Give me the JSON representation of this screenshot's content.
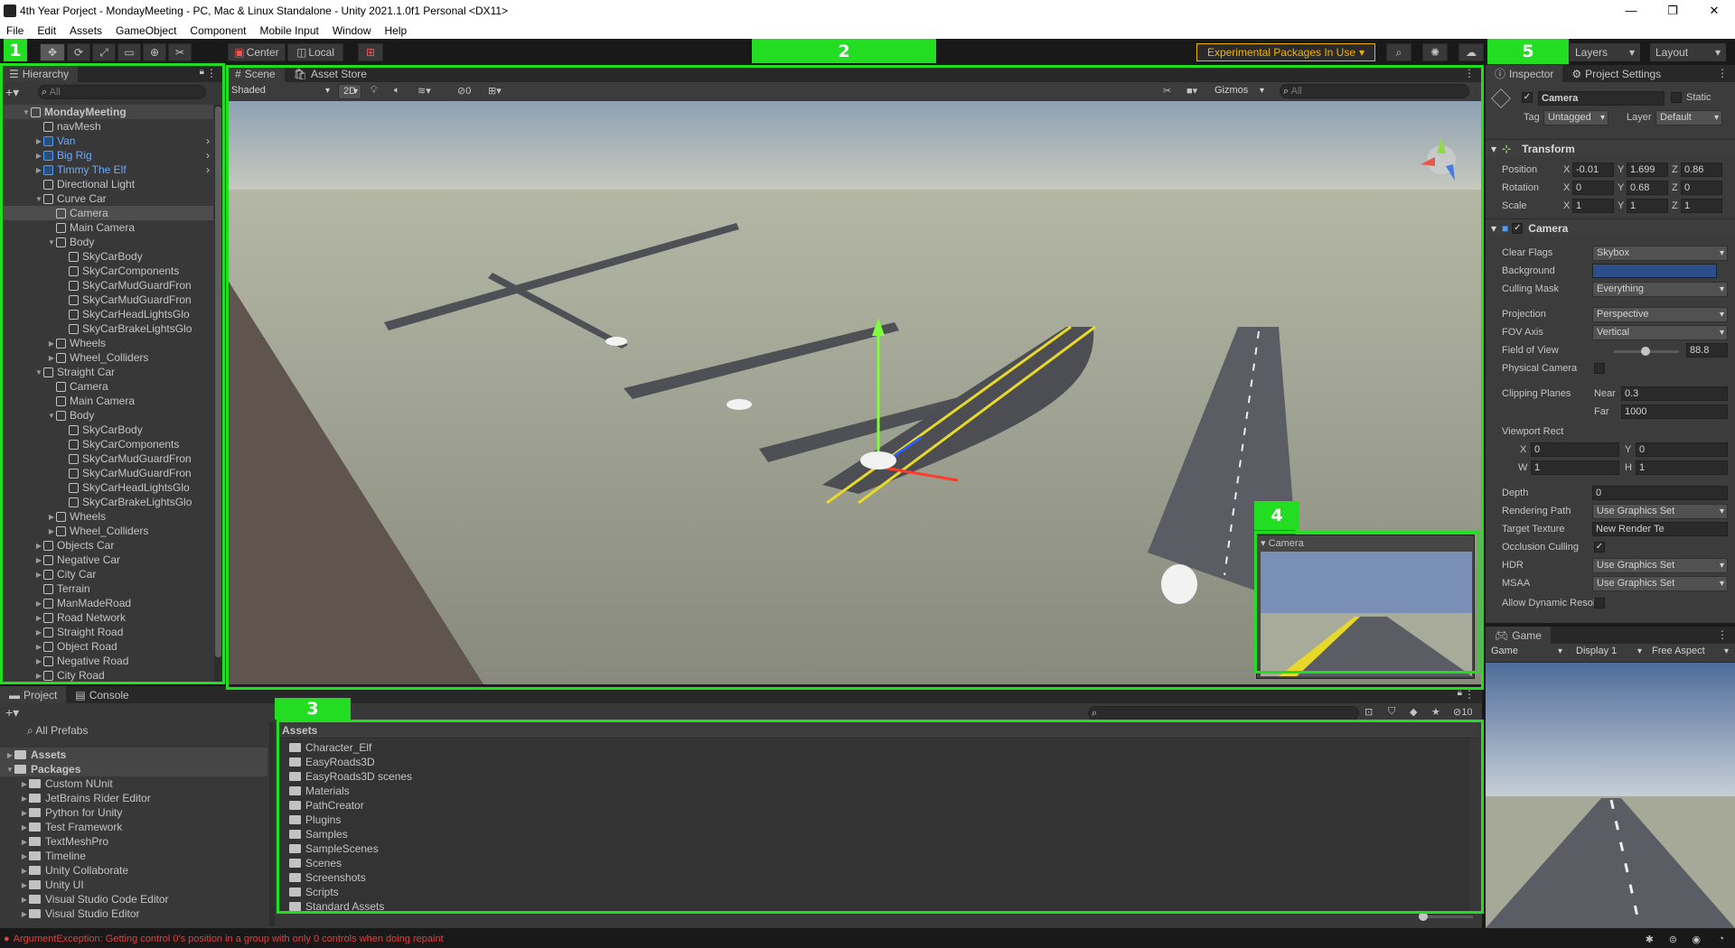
{
  "window": {
    "title": "4th Year Porject - MondayMeeting - PC, Mac & Linux Standalone - Unity 2021.1.0f1 Personal <DX11>",
    "controls": [
      "—",
      "❐",
      "✕"
    ]
  },
  "menu": [
    "File",
    "Edit",
    "Assets",
    "GameObject",
    "Component",
    "Mobile Input",
    "Window",
    "Help"
  ],
  "toolbar": {
    "pivot": "Center",
    "space": "Local",
    "experimental": "Experimental Packages In Use",
    "layers": "Layers",
    "layout": "Layout"
  },
  "callouts": [
    "1",
    "2",
    "3",
    "4",
    "5"
  ],
  "hierarchy": {
    "tab": "Hierarchy",
    "search_placeholder": "All",
    "items": [
      {
        "label": "MondayMeeting",
        "depth": 0,
        "arrow": "▼",
        "type": "scene"
      },
      {
        "label": "navMesh",
        "depth": 1,
        "arrow": "",
        "type": "obj"
      },
      {
        "label": "Van",
        "depth": 1,
        "arrow": "▶",
        "type": "prefab"
      },
      {
        "label": "Big Rig",
        "depth": 1,
        "arrow": "▶",
        "type": "prefab"
      },
      {
        "label": "Timmy The Elf",
        "depth": 1,
        "arrow": "▶",
        "type": "prefab"
      },
      {
        "label": "Directional Light",
        "depth": 1,
        "arrow": "",
        "type": "obj"
      },
      {
        "label": "Curve Car",
        "depth": 1,
        "arrow": "▼",
        "type": "obj"
      },
      {
        "label": "Camera",
        "depth": 2,
        "arrow": "",
        "type": "obj",
        "selected": true
      },
      {
        "label": "Main Camera",
        "depth": 2,
        "arrow": "",
        "type": "obj"
      },
      {
        "label": "Body",
        "depth": 2,
        "arrow": "▼",
        "type": "obj"
      },
      {
        "label": "SkyCarBody",
        "depth": 3,
        "arrow": "",
        "type": "obj"
      },
      {
        "label": "SkyCarComponents",
        "depth": 3,
        "arrow": "",
        "type": "obj"
      },
      {
        "label": "SkyCarMudGuardFron",
        "depth": 3,
        "arrow": "",
        "type": "obj"
      },
      {
        "label": "SkyCarMudGuardFron",
        "depth": 3,
        "arrow": "",
        "type": "obj"
      },
      {
        "label": "SkyCarHeadLightsGlo",
        "depth": 3,
        "arrow": "",
        "type": "obj"
      },
      {
        "label": "SkyCarBrakeLightsGlo",
        "depth": 3,
        "arrow": "",
        "type": "obj"
      },
      {
        "label": "Wheels",
        "depth": 2,
        "arrow": "▶",
        "type": "obj"
      },
      {
        "label": "Wheel_Colliders",
        "depth": 2,
        "arrow": "▶",
        "type": "obj"
      },
      {
        "label": "Straight Car",
        "depth": 1,
        "arrow": "▼",
        "type": "obj"
      },
      {
        "label": "Camera",
        "depth": 2,
        "arrow": "",
        "type": "obj"
      },
      {
        "label": "Main Camera",
        "depth": 2,
        "arrow": "",
        "type": "obj"
      },
      {
        "label": "Body",
        "depth": 2,
        "arrow": "▼",
        "type": "obj"
      },
      {
        "label": "SkyCarBody",
        "depth": 3,
        "arrow": "",
        "type": "obj"
      },
      {
        "label": "SkyCarComponents",
        "depth": 3,
        "arrow": "",
        "type": "obj"
      },
      {
        "label": "SkyCarMudGuardFron",
        "depth": 3,
        "arrow": "",
        "type": "obj"
      },
      {
        "label": "SkyCarMudGuardFron",
        "depth": 3,
        "arrow": "",
        "type": "obj"
      },
      {
        "label": "SkyCarHeadLightsGlo",
        "depth": 3,
        "arrow": "",
        "type": "obj"
      },
      {
        "label": "SkyCarBrakeLightsGlo",
        "depth": 3,
        "arrow": "",
        "type": "obj"
      },
      {
        "label": "Wheels",
        "depth": 2,
        "arrow": "▶",
        "type": "obj"
      },
      {
        "label": "Wheel_Colliders",
        "depth": 2,
        "arrow": "▶",
        "type": "obj"
      },
      {
        "label": "Objects Car",
        "depth": 1,
        "arrow": "▶",
        "type": "obj"
      },
      {
        "label": "Negative Car",
        "depth": 1,
        "arrow": "▶",
        "type": "obj"
      },
      {
        "label": "City Car",
        "depth": 1,
        "arrow": "▶",
        "type": "obj"
      },
      {
        "label": "Terrain",
        "depth": 1,
        "arrow": "",
        "type": "obj"
      },
      {
        "label": "ManMadeRoad",
        "depth": 1,
        "arrow": "▶",
        "type": "obj"
      },
      {
        "label": "Road Network",
        "depth": 1,
        "arrow": "▶",
        "type": "obj"
      },
      {
        "label": "Straight Road",
        "depth": 1,
        "arrow": "▶",
        "type": "obj"
      },
      {
        "label": "Object Road",
        "depth": 1,
        "arrow": "▶",
        "type": "obj"
      },
      {
        "label": "Negative Road",
        "depth": 1,
        "arrow": "▶",
        "type": "obj"
      },
      {
        "label": "City Road",
        "depth": 1,
        "arrow": "▶",
        "type": "obj"
      }
    ]
  },
  "scene": {
    "tabs": [
      "Scene",
      "Asset Store"
    ],
    "draw_mode": "Shaded",
    "mode_2d": "2D",
    "hidden_count": "0",
    "gizmos": "Gizmos",
    "search_placeholder": "All",
    "camera_preview_title": "Camera"
  },
  "project": {
    "tabs": [
      "Project",
      "Console"
    ],
    "favorites": "All Prefabs",
    "tree": [
      {
        "label": "Assets",
        "depth": 0,
        "arrow": "▶",
        "bold": true
      },
      {
        "label": "Packages",
        "depth": 0,
        "arrow": "▼",
        "bold": true
      },
      {
        "label": "Custom NUnit",
        "depth": 1,
        "arrow": "▶"
      },
      {
        "label": "JetBrains Rider Editor",
        "depth": 1,
        "arrow": "▶"
      },
      {
        "label": "Python for Unity",
        "depth": 1,
        "arrow": "▶"
      },
      {
        "label": "Test Framework",
        "depth": 1,
        "arrow": "▶"
      },
      {
        "label": "TextMeshPro",
        "depth": 1,
        "arrow": "▶"
      },
      {
        "label": "Timeline",
        "depth": 1,
        "arrow": "▶"
      },
      {
        "label": "Unity Collaborate",
        "depth": 1,
        "arrow": "▶"
      },
      {
        "label": "Unity UI",
        "depth": 1,
        "arrow": "▶"
      },
      {
        "label": "Visual Studio Code Editor",
        "depth": 1,
        "arrow": "▶"
      },
      {
        "label": "Visual Studio Editor",
        "depth": 1,
        "arrow": "▶"
      }
    ],
    "breadcrumb": "Assets",
    "hidden_count": "10",
    "assets": [
      "Character_Elf",
      "EasyRoads3D",
      "EasyRoads3D scenes",
      "Materials",
      "PathCreator",
      "Plugins",
      "Samples",
      "SampleScenes",
      "Scenes",
      "Screenshots",
      "Scripts",
      "Standard Assets"
    ]
  },
  "inspector": {
    "tabs": [
      "Inspector",
      "Project Settings"
    ],
    "object_name": "Camera",
    "static_label": "Static",
    "tag_label": "Tag",
    "tag_value": "Untagged",
    "layer_label": "Layer",
    "layer_value": "Default",
    "transform": {
      "title": "Transform",
      "rows": [
        {
          "label": "Position",
          "x": "-0.01",
          "y": "1.699",
          "z": "0.86"
        },
        {
          "label": "Rotation",
          "x": "0",
          "y": "0.68",
          "z": "0"
        },
        {
          "label": "Scale",
          "x": "1",
          "y": "1",
          "z": "1"
        }
      ]
    },
    "camera": {
      "title": "Camera",
      "clear_flags_label": "Clear Flags",
      "clear_flags": "Skybox",
      "background_label": "Background",
      "culling_mask_label": "Culling Mask",
      "culling_mask": "Everything",
      "projection_label": "Projection",
      "projection": "Perspective",
      "fov_axis_label": "FOV Axis",
      "fov_axis": "Vertical",
      "fov_label": "Field of View",
      "fov": "88.8",
      "fov_slider_fraction": 0.49,
      "physical_label": "Physical Camera",
      "clipping_label": "Clipping Planes",
      "near_label": "Near",
      "near": "0.3",
      "far_label": "Far",
      "far": "1000",
      "viewport_label": "Viewport Rect",
      "vp_x": "0",
      "vp_y": "0",
      "vp_w": "1",
      "vp_h": "1",
      "depth_label": "Depth",
      "depth": "0",
      "rendering_path_label": "Rendering Path",
      "rendering_path": "Use Graphics Set",
      "target_texture_label": "Target Texture",
      "target_texture": "New Render Te",
      "occlusion_label": "Occlusion Culling",
      "hdr_label": "HDR",
      "hdr": "Use Graphics Set",
      "msaa_label": "MSAA",
      "msaa": "Use Graphics Set",
      "dynamic_label": "Allow Dynamic Resol"
    }
  },
  "game": {
    "tab": "Game",
    "mode": "Game",
    "display": "Display 1",
    "aspect": "Free Aspect"
  },
  "status": {
    "error": "ArgumentException: Getting control 0's position in a group with only 0 controls when doing repaint"
  },
  "colors": {
    "callout_green": "#22dd22",
    "background_color": "#2c4f8a",
    "error_red": "#e04040",
    "prefab_blue": "#6ea9ff"
  }
}
